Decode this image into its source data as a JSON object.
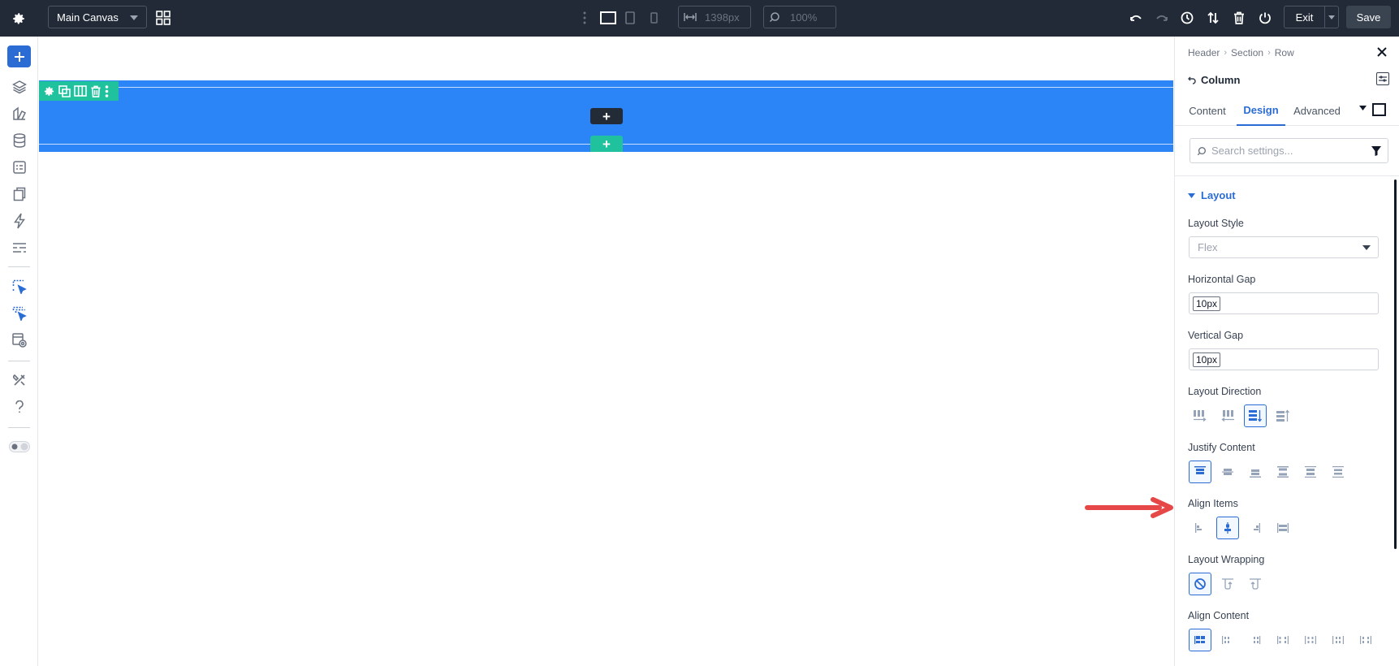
{
  "topbar": {
    "canvas_select": "Main Canvas",
    "width_value": "1398px",
    "zoom_value": "100%",
    "exit_label": "Exit",
    "save_label": "Save"
  },
  "panel": {
    "breadcrumb": [
      "Header",
      "Section",
      "Row"
    ],
    "module_title": "Column",
    "tabs": [
      "Content",
      "Design",
      "Advanced"
    ],
    "active_tab": "Design",
    "search_placeholder": "Search settings...",
    "group_title": "Layout",
    "fields": {
      "layout_style": {
        "label": "Layout Style",
        "value": "Flex"
      },
      "horizontal_gap": {
        "label": "Horizontal Gap",
        "value": "10px"
      },
      "vertical_gap": {
        "label": "Vertical Gap",
        "value": "10px"
      },
      "layout_direction": {
        "label": "Layout Direction",
        "selected_index": 2
      },
      "justify_content": {
        "label": "Justify Content",
        "selected_index": 0
      },
      "align_items": {
        "label": "Align Items",
        "selected_index": 1
      },
      "layout_wrapping": {
        "label": "Layout Wrapping",
        "selected_index": 0
      },
      "align_content": {
        "label": "Align Content",
        "selected_index": 0
      }
    }
  },
  "colors": {
    "topbar_bg": "#212a36",
    "accent_blue": "#2b6cd4",
    "section_blue": "#2b85f6",
    "row_green": "#1fc29d",
    "annotation_red": "#e64848"
  },
  "icons": {
    "leftbar": [
      "add-icon",
      "layers-icon",
      "palette-icon",
      "database-icon",
      "form-icon",
      "pages-icon",
      "lightning-icon",
      "list-icon",
      "select-pointer-icon",
      "multi-select-icon",
      "preview-icon",
      "tools-icon",
      "help-icon",
      "toggle-icon"
    ]
  }
}
